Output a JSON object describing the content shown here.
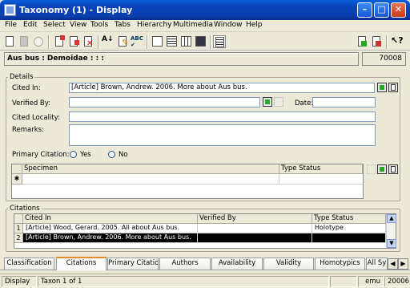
{
  "window": {
    "title": "Taxonomy (1) - Display"
  },
  "menu": [
    "File",
    "Edit",
    "Select",
    "View",
    "Tools",
    "Tabs",
    "Hierarchy",
    "Multimedia",
    "Window",
    "Help"
  ],
  "record": {
    "name": "Aus bus : Demoidae : : :",
    "irn": "70008"
  },
  "details": {
    "group_label": "Details",
    "cited_in_label": "Cited In:",
    "cited_in_value": "[Article] Brown, Andrew. 2006. More about Aus bus.",
    "verified_by_label": "Verified By:",
    "verified_by_value": "",
    "date_label": "Date:",
    "date_value": "",
    "cited_locality_label": "Cited Locality:",
    "cited_locality_value": "",
    "remarks_label": "Remarks:",
    "remarks_value": "",
    "primary_citation_label": "Primary Citation:",
    "yes_label": "Yes",
    "no_label": "No",
    "specimen_grid": {
      "columns": [
        "Specimen",
        "Type Status"
      ],
      "new_row_marker": "✱"
    }
  },
  "citations": {
    "group_label": "Citations",
    "columns": [
      "Cited In",
      "Verified By",
      "Type Status"
    ],
    "rows": [
      {
        "num": "1",
        "cited_in": "[Article] Wood, Gerard. 2005. All about Aus bus.",
        "verified_by": "",
        "type_status": "Holotype"
      },
      {
        "num": "2",
        "cited_in": "[Article] Brown, Andrew. 2006. More about Aus bus.",
        "verified_by": "",
        "type_status": ""
      }
    ]
  },
  "tabs": [
    "Classification",
    "Citations",
    "Primary Citation",
    "Authors",
    "Availability",
    "Validity",
    "Homotypics",
    "All Sy"
  ],
  "active_tab": "Citations",
  "status": {
    "mode": "Display",
    "record": "Taxon 1 of 1",
    "user": "emu",
    "port": "20006"
  }
}
